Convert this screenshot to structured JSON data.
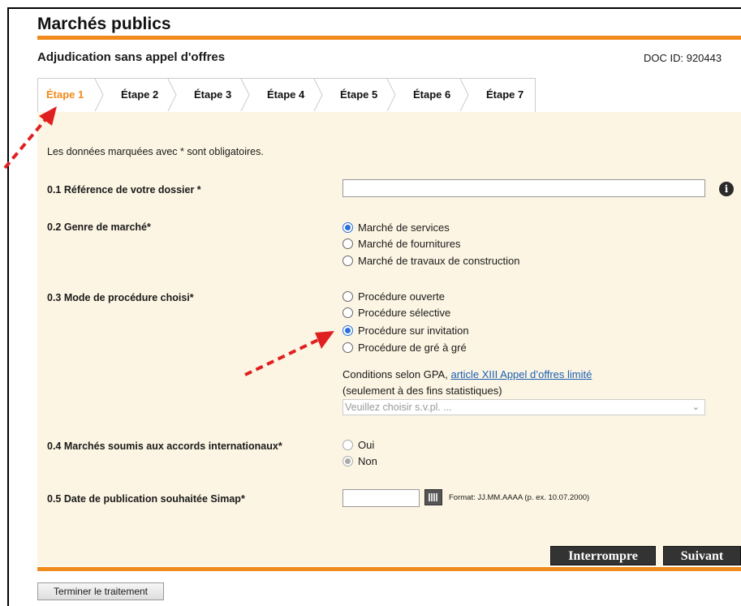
{
  "header": {
    "title": "Marchés publics",
    "subtitle": "Adjudication sans appel d'offres",
    "doc_id": "DOC ID: 920443"
  },
  "tabs": [
    "Étape 1",
    "Étape 2",
    "Étape 3",
    "Étape 4",
    "Étape 5",
    "Étape 6",
    "Étape 7"
  ],
  "active_tab": 0,
  "form": {
    "required_note": "Les données marquées avec * sont obligatoires.",
    "reference": {
      "label": "0.1 Référence de votre dossier *",
      "value": "",
      "info_icon": "i"
    },
    "genre": {
      "label": "0.2 Genre de marché*",
      "options": [
        "Marché de services",
        "Marché de fournitures",
        "Marché de travaux de construction"
      ],
      "selected": 0
    },
    "mode": {
      "label": "0.3 Mode de procédure choisi*",
      "options": [
        "Procédure ouverte",
        "Procédure sélective",
        "Procédure sur invitation",
        "Procédure de gré à gré"
      ],
      "selected": 2,
      "gpa_text": "Conditions selon GPA,",
      "gpa_link": "article XIII Appel d’offres limité",
      "gpa_note": "(seulement à des fins statistiques)",
      "select_placeholder": "Veuillez choisir s.v.pl. ..."
    },
    "international": {
      "label": "0.4 Marchés soumis aux accords internationaux*",
      "options": [
        "Oui",
        "Non"
      ],
      "selected": 1
    },
    "publication": {
      "label": "0.5 Date de publication souhaitée Simap*",
      "value": "",
      "format": "Format: JJ.MM.AAAA (p. ex. 10.07.2000)"
    }
  },
  "buttons": {
    "interrupt": "Interrompre",
    "next": "Suivant",
    "finish": "Terminer le traitement"
  },
  "colors": {
    "accent": "#f08a1c",
    "panel": "#fcf5e3",
    "annotation": "#e02020"
  }
}
